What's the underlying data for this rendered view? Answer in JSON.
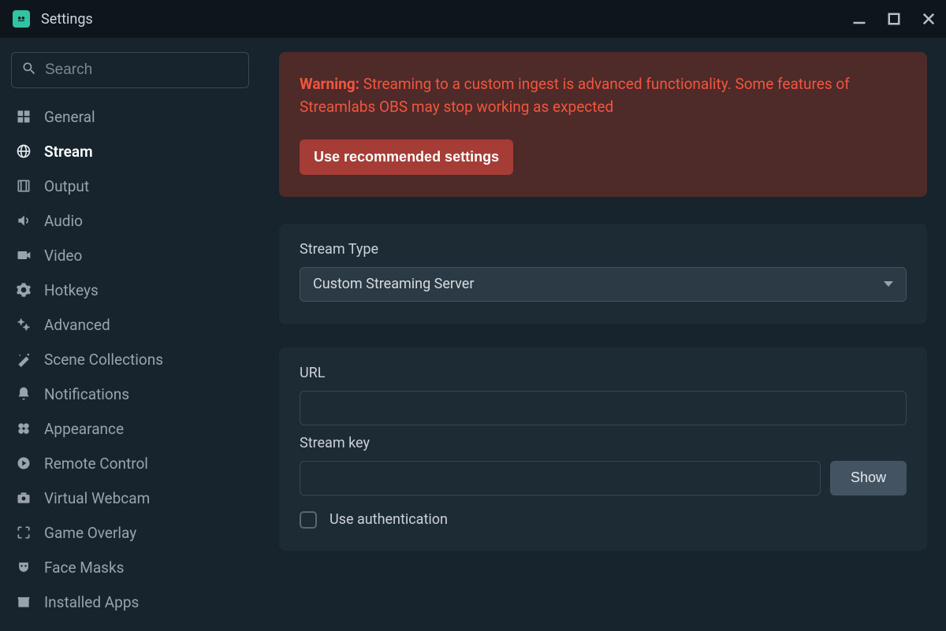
{
  "titlebar": {
    "title": "Settings"
  },
  "sidebar": {
    "search_placeholder": "Search",
    "items": [
      {
        "label": "General"
      },
      {
        "label": "Stream"
      },
      {
        "label": "Output"
      },
      {
        "label": "Audio"
      },
      {
        "label": "Video"
      },
      {
        "label": "Hotkeys"
      },
      {
        "label": "Advanced"
      },
      {
        "label": "Scene Collections"
      },
      {
        "label": "Notifications"
      },
      {
        "label": "Appearance"
      },
      {
        "label": "Remote Control"
      },
      {
        "label": "Virtual Webcam"
      },
      {
        "label": "Game Overlay"
      },
      {
        "label": "Face Masks"
      },
      {
        "label": "Installed Apps"
      }
    ],
    "active_index": 1
  },
  "warning": {
    "prefix": "Warning:",
    "message": "Streaming to a custom ingest is advanced functionality. Some features of Streamlabs OBS may stop working as expected",
    "button_label": "Use recommended settings"
  },
  "stream_type": {
    "label": "Stream Type",
    "value": "Custom Streaming Server"
  },
  "server": {
    "url_label": "URL",
    "url_value": "",
    "key_label": "Stream key",
    "key_value": "",
    "show_button": "Show",
    "auth_checkbox_label": "Use authentication",
    "auth_checked": false
  }
}
